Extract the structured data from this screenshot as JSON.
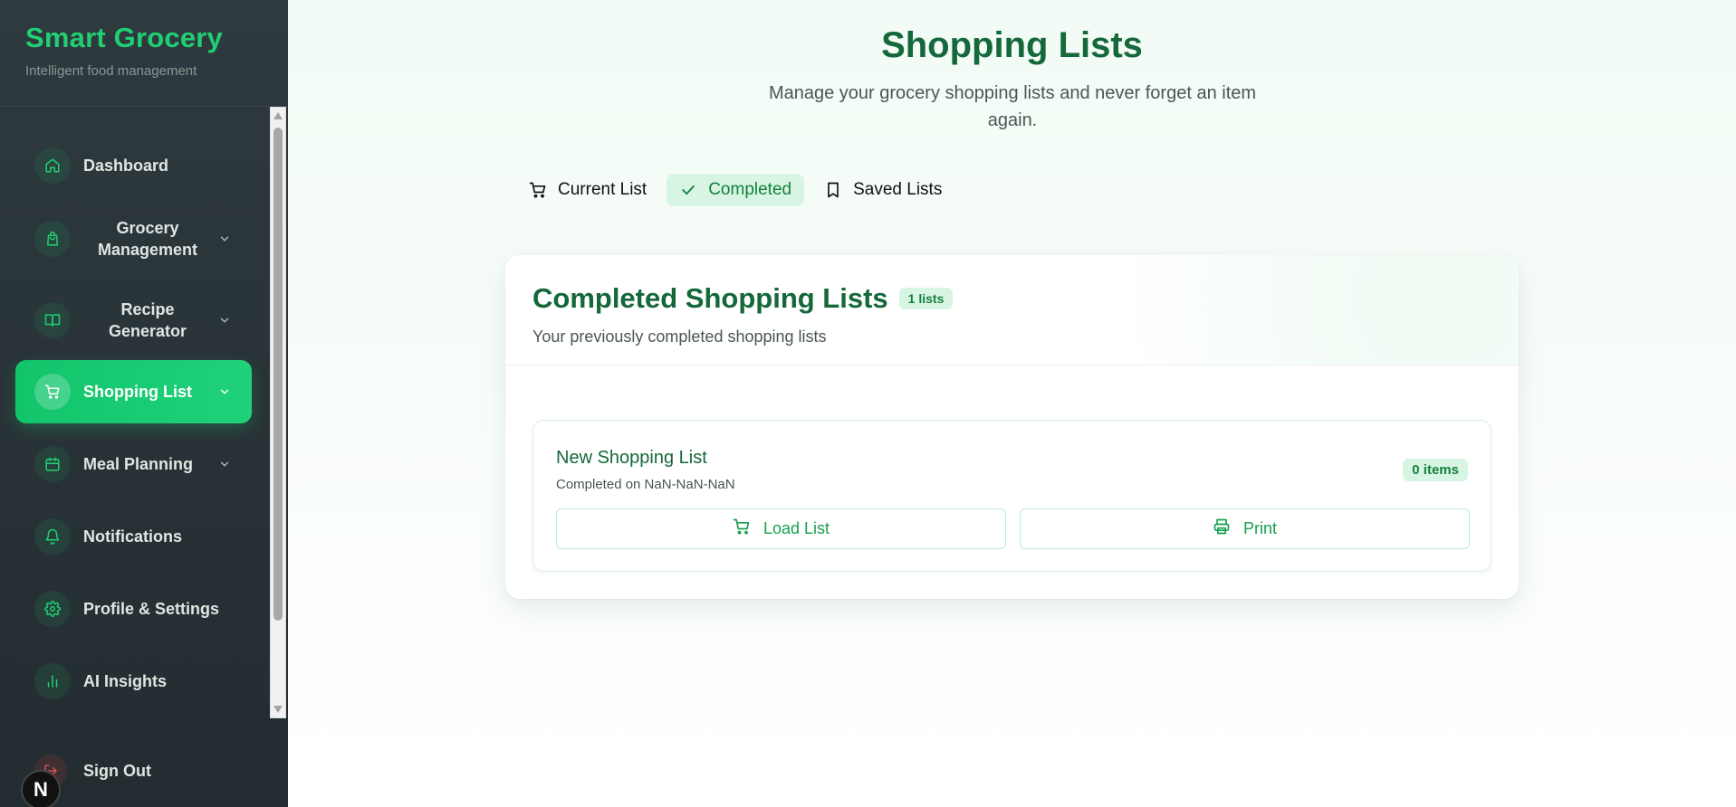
{
  "brand": {
    "title": "Smart Grocery",
    "subtitle": "Intelligent food management"
  },
  "sidebar": {
    "items": [
      {
        "label": "Dashboard",
        "icon": "home-icon"
      },
      {
        "label": "Grocery Management",
        "icon": "shopping-bag-icon"
      },
      {
        "label": "Recipe Generator",
        "icon": "book-icon"
      },
      {
        "label": "Shopping List",
        "icon": "cart-icon"
      },
      {
        "label": "Meal Planning",
        "icon": "calendar-icon"
      },
      {
        "label": "Notifications",
        "icon": "bell-icon"
      },
      {
        "label": "Profile & Settings",
        "icon": "gear-icon"
      },
      {
        "label": "AI Insights",
        "icon": "bar-chart-icon"
      }
    ],
    "sign_out": "Sign Out",
    "dev_badge": "N"
  },
  "header": {
    "title": "Shopping Lists",
    "subtitle": "Manage your grocery shopping lists and never forget an item again."
  },
  "tabs": [
    {
      "label": "Current List",
      "icon": "cart-icon"
    },
    {
      "label": "Completed",
      "icon": "check-icon"
    },
    {
      "label": "Saved Lists",
      "icon": "bookmark-icon"
    }
  ],
  "card": {
    "title": "Completed Shopping Lists",
    "count_badge": "1 lists",
    "subtitle": "Your previously completed shopping lists",
    "lists": [
      {
        "name": "New Shopping List",
        "completed": "Completed on NaN-NaN-NaN",
        "items_badge": "0 items",
        "load_label": "Load List",
        "print_label": "Print"
      }
    ]
  },
  "colors": {
    "accent": "#1fcf72",
    "title_green": "#14683a",
    "sidebar_bg": "#2a3539"
  }
}
